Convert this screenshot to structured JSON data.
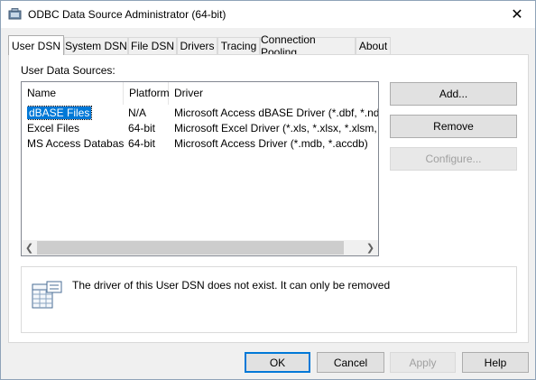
{
  "window": {
    "title": "ODBC Data Source Administrator (64-bit)"
  },
  "tabs": [
    {
      "label": "User DSN",
      "active": true
    },
    {
      "label": "System DSN"
    },
    {
      "label": "File DSN"
    },
    {
      "label": "Drivers"
    },
    {
      "label": "Tracing"
    },
    {
      "label": "Connection Pooling"
    },
    {
      "label": "About"
    }
  ],
  "user_dsn": {
    "list_label": "User Data Sources:",
    "columns": {
      "name": "Name",
      "platform": "Platform",
      "driver": "Driver"
    },
    "rows": [
      {
        "name": "dBASE Files",
        "platform": "N/A",
        "driver": "Microsoft Access dBASE Driver (*.dbf, *.ndx, *.m",
        "selected": true
      },
      {
        "name": "Excel Files",
        "platform": "64-bit",
        "driver": "Microsoft Excel Driver (*.xls, *.xlsx, *.xlsm, *.xlsb)"
      },
      {
        "name": "MS Access Database",
        "platform": "64-bit",
        "driver": "Microsoft Access Driver (*.mdb, *.accdb)"
      }
    ],
    "buttons": {
      "add": "Add...",
      "remove": "Remove",
      "configure": "Configure..."
    },
    "info_text": "The driver of this User DSN does not exist. It can only be removed"
  },
  "dialog_buttons": {
    "ok": "OK",
    "cancel": "Cancel",
    "apply": "Apply",
    "help": "Help"
  },
  "icons": {
    "app": "odbc-admin-icon",
    "close": "close-icon",
    "info": "data-sheet-icon"
  },
  "colors": {
    "selection": "#0078d7",
    "default_button_border": "#0078d7"
  }
}
